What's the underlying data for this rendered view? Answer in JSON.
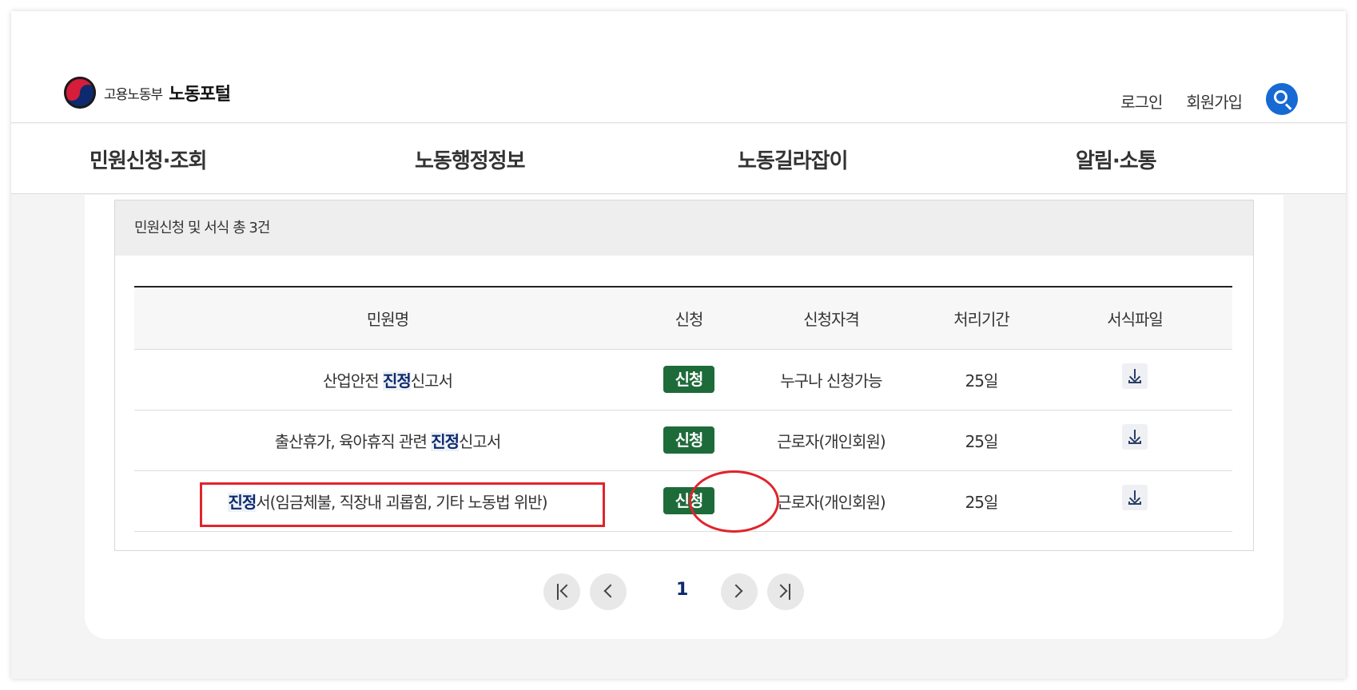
{
  "header": {
    "ministry": "고용노동부",
    "portal": "노동포털",
    "login": "로그인",
    "signup": "회원가입"
  },
  "gnb": [
    {
      "label": "민원신청·조회"
    },
    {
      "label": "노동행정정보"
    },
    {
      "label": "노동길라잡이"
    },
    {
      "label": "알림·소통"
    }
  ],
  "result": {
    "summary": "민원신청 및 서식 총 3건",
    "columns": [
      "민원명",
      "신청",
      "신청자격",
      "처리기간",
      "서식파일"
    ],
    "rows": [
      {
        "name_pre": "산업안전 ",
        "name_hl": "진정",
        "name_post": "신고서",
        "apply": "신청",
        "qualification": "누구나 신청가능",
        "period": "25일"
      },
      {
        "name_pre": "출산휴가, 육아휴직 관련 ",
        "name_hl": "진정",
        "name_post": "신고서",
        "apply": "신청",
        "qualification": "근로자(개인회원)",
        "period": "25일"
      },
      {
        "name_pre": "",
        "name_hl": "진정",
        "name_post": "서(임금체불, 직장내 괴롭힘, 기타 노동법 위반)",
        "apply": "신청",
        "qualification": "근로자(개인회원)",
        "period": "25일"
      }
    ]
  },
  "pagination": {
    "current": "1"
  },
  "colors": {
    "apply_button": "#1e6b3a",
    "highlight_text": "#0d2a6e",
    "search_button": "#1769d4",
    "annotation": "#e0242b"
  }
}
